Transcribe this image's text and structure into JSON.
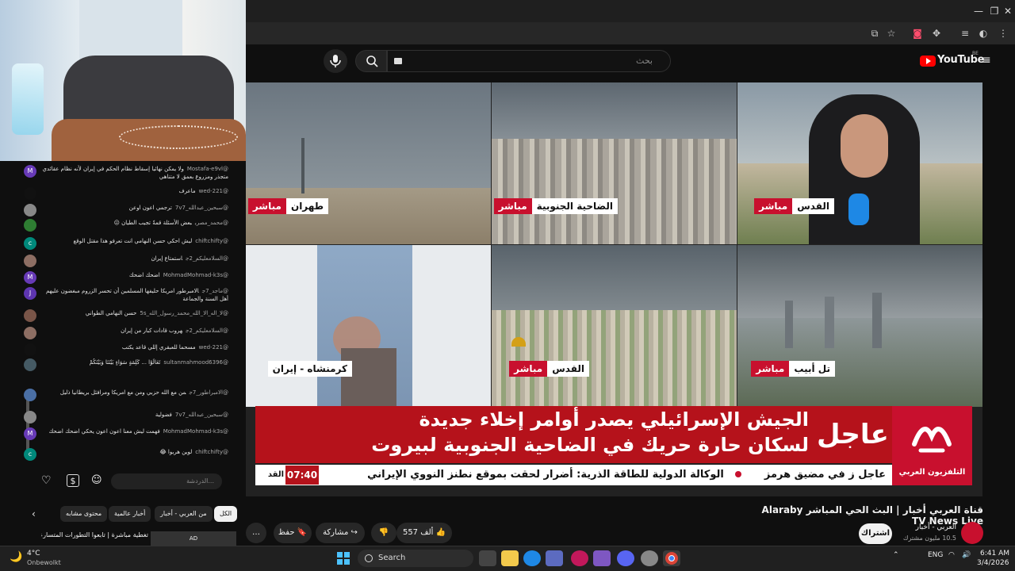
{
  "browser": {
    "window_controls": [
      "—",
      "❐",
      "✕"
    ],
    "toolbar_icons": [
      "cast-icon",
      "star-icon",
      "extension-icon",
      "puzzle-icon",
      "list-icon",
      "profile-icon",
      "menu-icon"
    ]
  },
  "youtube": {
    "logo": "YouTube",
    "country": "BE",
    "search_placeholder": "بحث",
    "video": {
      "tiles": [
        {
          "place": "طهران",
          "live": "مباشر"
        },
        {
          "place": "الضاحية الجنوبية",
          "live": "مباشر"
        },
        {
          "place": "القدس",
          "live": "مباشر"
        },
        {
          "place": "كرمنشاه - إيران",
          "live": ""
        },
        {
          "place": "القدس",
          "live": "مباشر"
        },
        {
          "place": "تل أبيب",
          "live": "مباشر"
        }
      ],
      "breaking_label": "عاجل",
      "headline_line1": "الجيش الإسرائيلي يصدر أوامر إخلاء جديدة",
      "headline_line2": "لسكان حارة حريك في الضاحية الجنوبية لبيروت",
      "channel_logo_name": "التلفزيون العربي",
      "ticker_text": "الوكالة الدولية للطاقة الذرية: أضرار لحقت بموقع نطنز النووي الإيراني",
      "ticker_prefix": "عاجل  ز في مضيق هرمز",
      "ticker_tail": "القد",
      "clock": "07:40"
    },
    "title": "قناة العربي أخبار | البث الحي المباشر Alaraby TV News Live",
    "channel": {
      "name": "العربي - أخبار",
      "subscribers": "10.5 مليون مشترك",
      "subscribe_label": "اشتراك"
    },
    "actions": {
      "likes": "557 ألف",
      "share": "مشاركة",
      "save": "حفظ",
      "more": "…"
    },
    "chips": [
      "الكل",
      "من العربي - أخبار",
      "أخبار عالمية",
      "محتوى مشابه"
    ],
    "next_video": {
      "title": "تغطية مباشرة | تابعوا التطورات المتسارعة ل",
      "badge": "AD"
    }
  },
  "chat": {
    "messages": [
      {
        "author": "@Mostafa-e9vl",
        "text": "ولا يمكن نهائيا إسقاط نظام الحكم في إيران لأنه نظام عقائدي متجذر ومزروع بعمق لا متناهي",
        "initial": "M",
        "color": "#673ab7"
      },
      {
        "author": "@wed-221",
        "text": "ماعرف",
        "initial": "",
        "color": "#111111"
      },
      {
        "author": "@سبحين_عبدالله_7v7",
        "text": "ترجمي اعون اوعن",
        "initial": "",
        "color": "#888888"
      },
      {
        "author": "@محمد_مصري",
        "text": "بعض الأسئلة قمةً تجيب الطيان 😖",
        "initial": "",
        "color": "#2e7d32"
      },
      {
        "author": "@chiftchifty",
        "text": "ليش احكي حسن النهامي انت تعرفو هذا مقتل الوقع",
        "initial": "c",
        "color": "#00897b"
      },
      {
        "author": "@السلامعليكم_2ج",
        "text": "استمتاع إيران",
        "initial": "",
        "color": "#8d6e63"
      },
      {
        "author": "@MohmadMohmad-k3s",
        "text": "اضحك اضحك",
        "initial": "M",
        "color": "#673ab7"
      },
      {
        "author": "@ماجد_7ج",
        "text": "الامبرطور امريكا حليفها المسلمين أن تحسر الزروم مبغضون عليهم أهل السنة والجماعة",
        "initial": "J",
        "color": "#5e35b1"
      },
      {
        "author": "@لا_اله_الا_الله_محمد_رسول_الله_5s",
        "text": "حسن النهامي الطواني",
        "initial": "",
        "color": "#795548"
      },
      {
        "author": "@السلامعليكم_2ج",
        "text": "هروب قادات كبار من إيران",
        "initial": "",
        "color": "#8d6e63"
      },
      {
        "author": "@wed-221",
        "text": "مسحما للعبقري إللي قاعد يكتب",
        "initial": "",
        "color": "#111111"
      },
      {
        "author": "@sultanmahmood6396",
        "text": "تَعَالَوْا ... كَلِمَةٍ سَوَاءٍ بَيْنَنَا وَبَيْنَكُمْ",
        "initial": "",
        "color": "#455a64"
      },
      {
        "author": "@الامبراطور_7ج",
        "text": "من مع الله حزبي ومن مع امريكا ومرافئل بريطانيا ذليل",
        "initial": "",
        "color": "#4a6fa5"
      },
      {
        "author": "@سبحين_عبدالله_7v7",
        "text": "فضولية",
        "initial": "",
        "color": "#888888"
      },
      {
        "author": "@MohmadMohmad-k3s",
        "text": "فهمت ليش معنا اعون اعون يحكي اضحك اضحك",
        "initial": "M",
        "color": "#673ab7"
      },
      {
        "author": "@chiftchifty",
        "text": "لوين هربوا 😂",
        "initial": "c",
        "color": "#00897b"
      }
    ],
    "input_placeholder": "الدردشة..."
  },
  "taskbar": {
    "weather_temp": "4°C",
    "weather_text": "Onbewolkt",
    "search": "Search",
    "lang": "ENG",
    "time": "6:41 AM",
    "date": "3/4/2026"
  }
}
